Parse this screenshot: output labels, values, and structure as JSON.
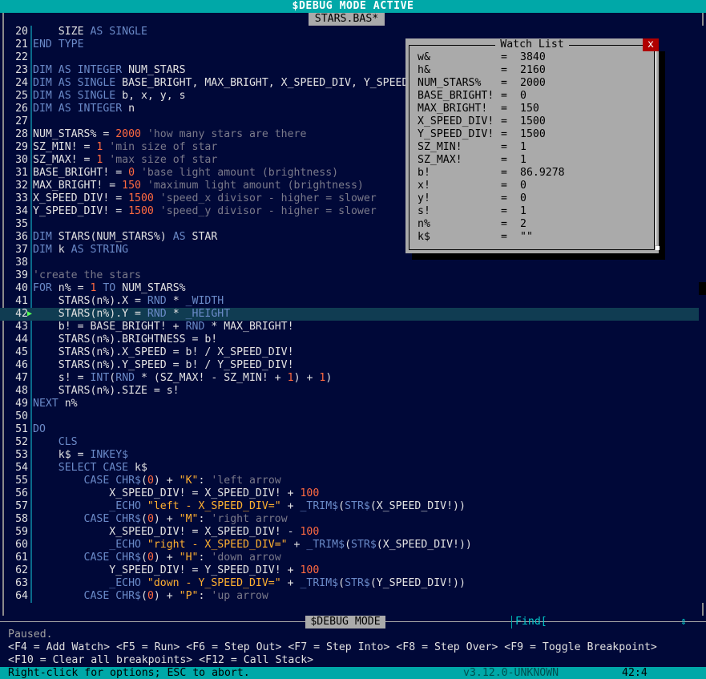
{
  "top_bar": {
    "title": "$DEBUG MODE ACTIVE"
  },
  "file_tab": {
    "name": "STARS.BAS*"
  },
  "code_lines": [
    {
      "n": "20",
      "current": false,
      "segs": [
        [
          "id",
          "    SIZE "
        ],
        [
          "kw",
          "AS SINGLE"
        ]
      ]
    },
    {
      "n": "21",
      "current": false,
      "segs": [
        [
          "kw",
          "END TYPE"
        ]
      ]
    },
    {
      "n": "22",
      "current": false,
      "segs": []
    },
    {
      "n": "23",
      "current": false,
      "segs": [
        [
          "kw",
          "DIM AS INTEGER "
        ],
        [
          "id",
          "NUM_STARS"
        ]
      ]
    },
    {
      "n": "24",
      "current": false,
      "segs": [
        [
          "kw",
          "DIM AS SINGLE "
        ],
        [
          "id",
          "BASE_BRIGHT, MAX_BRIGHT, X_SPEED_DIV, Y_SPEED_DIV"
        ]
      ]
    },
    {
      "n": "25",
      "current": false,
      "segs": [
        [
          "kw",
          "DIM AS SINGLE "
        ],
        [
          "id",
          "b, x, y, s"
        ]
      ]
    },
    {
      "n": "26",
      "current": false,
      "segs": [
        [
          "kw",
          "DIM AS INTEGER "
        ],
        [
          "id",
          "n"
        ]
      ]
    },
    {
      "n": "27",
      "current": false,
      "segs": []
    },
    {
      "n": "28",
      "current": false,
      "segs": [
        [
          "id",
          "NUM_STARS% = "
        ],
        [
          "num",
          "2000"
        ],
        [
          "cmt",
          " 'how many stars are there"
        ]
      ]
    },
    {
      "n": "29",
      "current": false,
      "segs": [
        [
          "id",
          "SZ_MIN! = "
        ],
        [
          "num",
          "1"
        ],
        [
          "cmt",
          " 'min size of star"
        ]
      ]
    },
    {
      "n": "30",
      "current": false,
      "segs": [
        [
          "id",
          "SZ_MAX! = "
        ],
        [
          "num",
          "1"
        ],
        [
          "cmt",
          " 'max size of star"
        ]
      ]
    },
    {
      "n": "31",
      "current": false,
      "segs": [
        [
          "id",
          "BASE_BRIGHT! = "
        ],
        [
          "num",
          "0"
        ],
        [
          "cmt",
          " 'base light amount (brightness)"
        ]
      ]
    },
    {
      "n": "32",
      "current": false,
      "segs": [
        [
          "id",
          "MAX_BRIGHT! = "
        ],
        [
          "num",
          "150"
        ],
        [
          "cmt",
          " 'maximum light amount (brightness)"
        ]
      ]
    },
    {
      "n": "33",
      "current": false,
      "segs": [
        [
          "id",
          "X_SPEED_DIV! = "
        ],
        [
          "num",
          "1500"
        ],
        [
          "cmt",
          " 'speed_x divisor - higher = slower"
        ]
      ]
    },
    {
      "n": "34",
      "current": false,
      "segs": [
        [
          "id",
          "Y_SPEED_DIV! = "
        ],
        [
          "num",
          "1500"
        ],
        [
          "cmt",
          " 'speed_y divisor - higher = slower"
        ]
      ]
    },
    {
      "n": "35",
      "current": false,
      "segs": []
    },
    {
      "n": "36",
      "current": false,
      "segs": [
        [
          "kw",
          "DIM "
        ],
        [
          "id",
          "STARS(NUM_STARS%) "
        ],
        [
          "kw",
          "AS "
        ],
        [
          "id",
          "STAR"
        ]
      ]
    },
    {
      "n": "37",
      "current": false,
      "segs": [
        [
          "kw",
          "DIM "
        ],
        [
          "id",
          "k "
        ],
        [
          "kw",
          "AS STRING"
        ]
      ]
    },
    {
      "n": "38",
      "current": false,
      "segs": []
    },
    {
      "n": "39",
      "current": false,
      "segs": [
        [
          "cmt",
          "'create the stars"
        ]
      ]
    },
    {
      "n": "40",
      "current": false,
      "segs": [
        [
          "kw",
          "FOR "
        ],
        [
          "id",
          "n% = "
        ],
        [
          "num",
          "1"
        ],
        [
          "kw",
          " TO "
        ],
        [
          "id",
          "NUM_STARS%"
        ]
      ]
    },
    {
      "n": "41",
      "current": false,
      "segs": [
        [
          "id",
          "    STARS(n%).X = "
        ],
        [
          "kw",
          "RND"
        ],
        [
          "id",
          " * "
        ],
        [
          "kw",
          "_WIDTH"
        ]
      ]
    },
    {
      "n": "42",
      "current": true,
      "segs": [
        [
          "id",
          "    STARS(n%).Y = "
        ],
        [
          "kw",
          "RND"
        ],
        [
          "id",
          " * "
        ],
        [
          "kw",
          "_HEIGHT"
        ]
      ]
    },
    {
      "n": "43",
      "current": false,
      "segs": [
        [
          "id",
          "    b! = BASE_BRIGHT! + "
        ],
        [
          "kw",
          "RND"
        ],
        [
          "id",
          " * MAX_BRIGHT!"
        ]
      ]
    },
    {
      "n": "44",
      "current": false,
      "segs": [
        [
          "id",
          "    STARS(n%).BRIGHTNESS = b!"
        ]
      ]
    },
    {
      "n": "45",
      "current": false,
      "segs": [
        [
          "id",
          "    STARS(n%).X_SPEED = b! / X_SPEED_DIV!"
        ]
      ]
    },
    {
      "n": "46",
      "current": false,
      "segs": [
        [
          "id",
          "    STARS(n%).Y_SPEED = b! / Y_SPEED_DIV!"
        ]
      ]
    },
    {
      "n": "47",
      "current": false,
      "segs": [
        [
          "id",
          "    s! = "
        ],
        [
          "kw",
          "INT"
        ],
        [
          "id",
          "("
        ],
        [
          "kw",
          "RND"
        ],
        [
          "id",
          " * (SZ_MAX! - SZ_MIN! + "
        ],
        [
          "num",
          "1"
        ],
        [
          "id",
          ") + "
        ],
        [
          "num",
          "1"
        ],
        [
          "id",
          ")"
        ]
      ]
    },
    {
      "n": "48",
      "current": false,
      "segs": [
        [
          "id",
          "    STARS(n%).SIZE = s!"
        ]
      ]
    },
    {
      "n": "49",
      "current": false,
      "segs": [
        [
          "kw",
          "NEXT "
        ],
        [
          "id",
          "n%"
        ]
      ]
    },
    {
      "n": "50",
      "current": false,
      "segs": []
    },
    {
      "n": "51",
      "current": false,
      "segs": [
        [
          "kw",
          "DO"
        ]
      ]
    },
    {
      "n": "52",
      "current": false,
      "segs": [
        [
          "kw",
          "    CLS"
        ]
      ]
    },
    {
      "n": "53",
      "current": false,
      "segs": [
        [
          "id",
          "    k$ = "
        ],
        [
          "kw",
          "INKEY$"
        ]
      ]
    },
    {
      "n": "54",
      "current": false,
      "segs": [
        [
          "kw",
          "    SELECT CASE "
        ],
        [
          "id",
          "k$"
        ]
      ]
    },
    {
      "n": "55",
      "current": false,
      "segs": [
        [
          "kw",
          "        CASE CHR$"
        ],
        [
          "id",
          "("
        ],
        [
          "num",
          "0"
        ],
        [
          "id",
          ") + "
        ],
        [
          "str",
          "\"K\""
        ],
        [
          "id",
          ": "
        ],
        [
          "cmt",
          "'left arrow"
        ]
      ]
    },
    {
      "n": "56",
      "current": false,
      "segs": [
        [
          "id",
          "            X_SPEED_DIV! = X_SPEED_DIV! + "
        ],
        [
          "num",
          "100"
        ]
      ]
    },
    {
      "n": "57",
      "current": false,
      "segs": [
        [
          "kw",
          "            _ECHO "
        ],
        [
          "str",
          "\"left - X_SPEED_DIV=\""
        ],
        [
          "id",
          " + "
        ],
        [
          "kw",
          "_TRIM$"
        ],
        [
          "id",
          "("
        ],
        [
          "kw",
          "STR$"
        ],
        [
          "id",
          "(X_SPEED_DIV!))"
        ]
      ]
    },
    {
      "n": "58",
      "current": false,
      "segs": [
        [
          "kw",
          "        CASE CHR$"
        ],
        [
          "id",
          "("
        ],
        [
          "num",
          "0"
        ],
        [
          "id",
          ") + "
        ],
        [
          "str",
          "\"M\""
        ],
        [
          "id",
          ": "
        ],
        [
          "cmt",
          "'right arrow"
        ]
      ]
    },
    {
      "n": "59",
      "current": false,
      "segs": [
        [
          "id",
          "            X_SPEED_DIV! = X_SPEED_DIV! - "
        ],
        [
          "num",
          "100"
        ]
      ]
    },
    {
      "n": "60",
      "current": false,
      "segs": [
        [
          "kw",
          "            _ECHO "
        ],
        [
          "str",
          "\"right - X_SPEED_DIV=\""
        ],
        [
          "id",
          " + "
        ],
        [
          "kw",
          "_TRIM$"
        ],
        [
          "id",
          "("
        ],
        [
          "kw",
          "STR$"
        ],
        [
          "id",
          "(X_SPEED_DIV!))"
        ]
      ]
    },
    {
      "n": "61",
      "current": false,
      "segs": [
        [
          "kw",
          "        CASE CHR$"
        ],
        [
          "id",
          "("
        ],
        [
          "num",
          "0"
        ],
        [
          "id",
          ") + "
        ],
        [
          "str",
          "\"H\""
        ],
        [
          "id",
          ": "
        ],
        [
          "cmt",
          "'down arrow"
        ]
      ]
    },
    {
      "n": "62",
      "current": false,
      "segs": [
        [
          "id",
          "            Y_SPEED_DIV! = Y_SPEED_DIV! + "
        ],
        [
          "num",
          "100"
        ]
      ]
    },
    {
      "n": "63",
      "current": false,
      "segs": [
        [
          "kw",
          "            _ECHO "
        ],
        [
          "str",
          "\"down - Y_SPEED_DIV=\""
        ],
        [
          "id",
          " + "
        ],
        [
          "kw",
          "_TRIM$"
        ],
        [
          "id",
          "("
        ],
        [
          "kw",
          "STR$"
        ],
        [
          "id",
          "(Y_SPEED_DIV!))"
        ]
      ]
    },
    {
      "n": "64",
      "current": false,
      "segs": [
        [
          "kw",
          "        CASE CHR$"
        ],
        [
          "id",
          "("
        ],
        [
          "num",
          "0"
        ],
        [
          "id",
          ") + "
        ],
        [
          "str",
          "\"P\""
        ],
        [
          "id",
          ": "
        ],
        [
          "cmt",
          "'up arrow"
        ]
      ]
    }
  ],
  "watch_list": {
    "title": "Watch List",
    "close_label": "x",
    "items": [
      {
        "name": "w&",
        "value": "3840"
      },
      {
        "name": "h&",
        "value": "2160"
      },
      {
        "name": "NUM_STARS%",
        "value": "2000"
      },
      {
        "name": "BASE_BRIGHT!",
        "value": "0"
      },
      {
        "name": "MAX_BRIGHT!",
        "value": "150"
      },
      {
        "name": "X_SPEED_DIV!",
        "value": "1500"
      },
      {
        "name": "Y_SPEED_DIV!",
        "value": "1500"
      },
      {
        "name": "SZ_MIN!",
        "value": "1"
      },
      {
        "name": "SZ_MAX!",
        "value": "1"
      },
      {
        "name": "b!",
        "value": "86.9278"
      },
      {
        "name": "x!",
        "value": "0"
      },
      {
        "name": "y!",
        "value": "0"
      },
      {
        "name": "s!",
        "value": "1"
      },
      {
        "name": "n%",
        "value": "2"
      },
      {
        "name": "k$",
        "value": "\"\""
      }
    ]
  },
  "bottom_panel": {
    "label": "$DEBUG MODE",
    "find_label": "Find[",
    "find_arrows": "⇕",
    "status_message": "Paused.",
    "keys_line1": "<F4 = Add Watch> <F5 = Run> <F6 = Step Out> <F7 = Step Into> <F8 = Step Over> <F9 = Toggle Breakpoint>",
    "keys_line2": "<F10 = Clear all breakpoints> <F12 = Call Stack>"
  },
  "status_bar": {
    "hint": "Right-click for options; ESC to abort.",
    "version": "v3.12.0-UNKNOWN",
    "position": "42:4"
  }
}
